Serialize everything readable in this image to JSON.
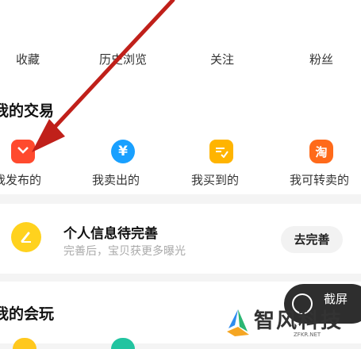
{
  "stats": [
    {
      "label": "收藏"
    },
    {
      "label": "历史浏览"
    },
    {
      "label": "关注"
    },
    {
      "label": "粉丝"
    }
  ],
  "trade": {
    "title": "我的交易",
    "items": [
      {
        "label": "我发布的",
        "icon": "publish-bag-icon",
        "color": "#ff4a2e"
      },
      {
        "label": "我卖出的",
        "icon": "yen-coin-icon",
        "color": "#19a0ff"
      },
      {
        "label": "我买到的",
        "icon": "receipt-check-icon",
        "color": "#ffb400"
      },
      {
        "label": "我可转卖的",
        "icon": "tao-badge-icon",
        "color": "#ff6a1a"
      }
    ]
  },
  "profile_card": {
    "title": "个人信息待完善",
    "subtitle": "完善后，宝贝获更多曝光",
    "button": "去完善",
    "icon": "pencil-icon"
  },
  "play": {
    "title": "我的会玩"
  },
  "floating": {
    "label": "截屏"
  },
  "watermark": {
    "text": "智风科技",
    "sub": "ZFKR.NET"
  },
  "colors": {
    "arrow": "#c0201a",
    "accent_yellow": "#ffd21e"
  }
}
